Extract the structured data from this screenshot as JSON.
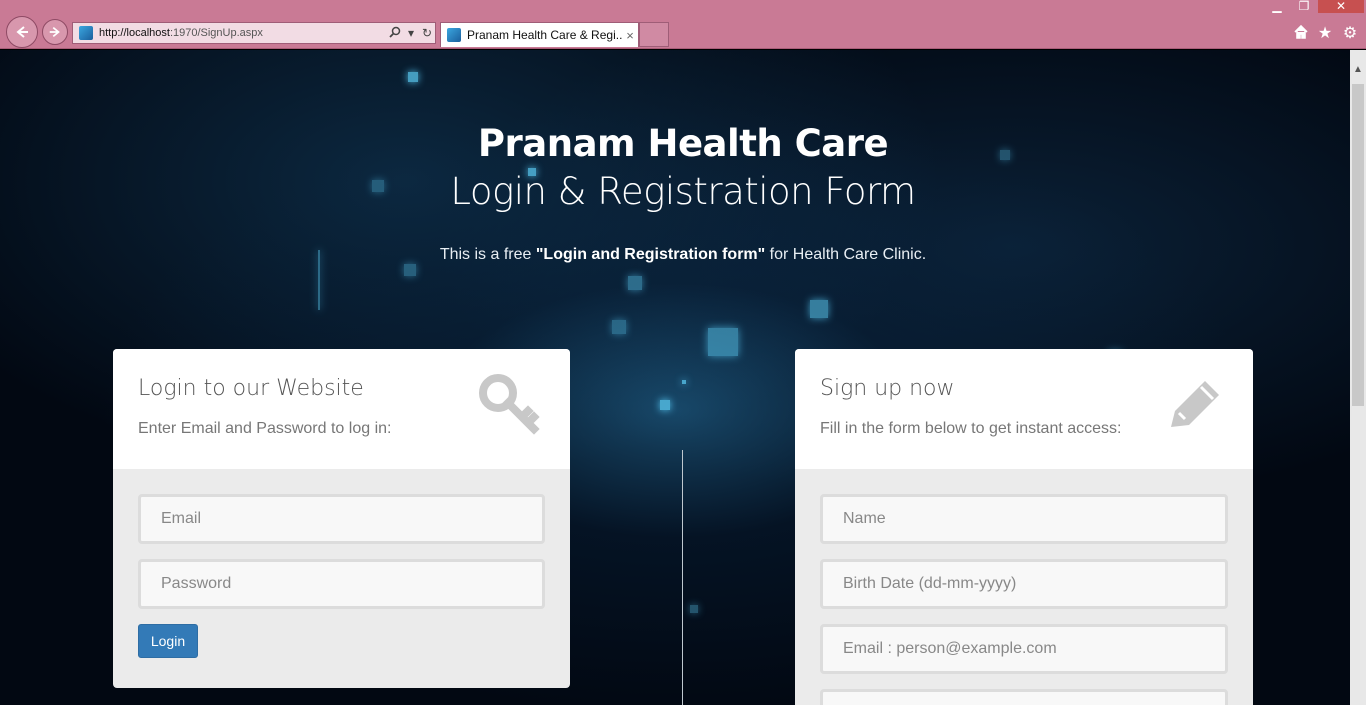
{
  "browser": {
    "url_host": "http://localhost",
    "url_path": ":1970/SignUp.aspx",
    "tab_title": "Pranam Health Care & Regi...",
    "tab_close": "×"
  },
  "hero": {
    "title": "Pranam Health Care",
    "subtitle": "Login & Registration Form",
    "desc_prefix": "This is a free ",
    "desc_bold": "\"Login and Registration form\"",
    "desc_suffix": " for Health Care Clinic."
  },
  "login": {
    "title": "Login to our Website",
    "description": "Enter Email and Password to log in:",
    "icon": "key-icon",
    "email_placeholder": "Email",
    "password_placeholder": "Password",
    "button_label": "Login"
  },
  "signup": {
    "title": "Sign up now",
    "description": "Fill in the form below to get instant access:",
    "icon": "pencil-icon",
    "name_placeholder": "Name",
    "birthdate_placeholder": "Birth Date (dd-mm-yyyy)",
    "email_placeholder": "Email : person@example.com"
  },
  "colors": {
    "chrome": "#c97a95",
    "login_button": "#337ab7",
    "card_body": "#ebebeb"
  }
}
